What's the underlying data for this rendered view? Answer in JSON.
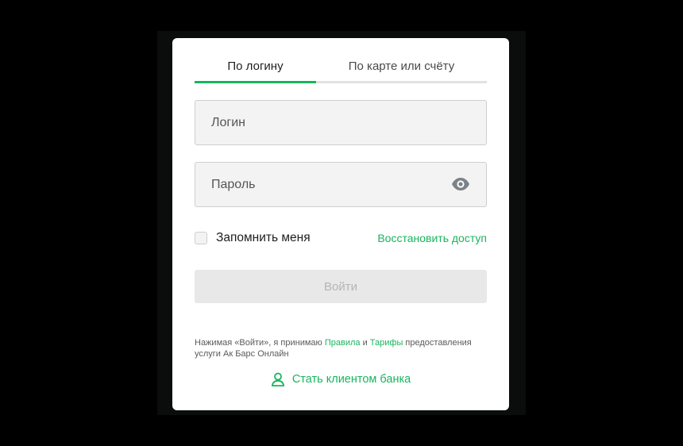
{
  "tabs": [
    {
      "label": "По логину",
      "active": true
    },
    {
      "label": "По карте или счёту",
      "active": false
    }
  ],
  "login": {
    "placeholder": "Логин",
    "value": ""
  },
  "password": {
    "placeholder": "Пароль",
    "value": "",
    "toggle_icon": "eye-icon"
  },
  "remember": {
    "label": "Запомнить меня",
    "checked": false
  },
  "restore_link": "Восстановить доступ",
  "submit": {
    "label": "Войти",
    "enabled": false
  },
  "terms": {
    "prefix": "Нажимая «Войти», я принимаю",
    "rules_link": "Правила",
    "and": "и",
    "tariffs_link": "Тарифы",
    "suffix": "предоставления услуги Ак Барс Онлайн"
  },
  "become_client": {
    "label": "Стать клиентом банка",
    "icon": "user-icon"
  },
  "colors": {
    "accent": "#17b55e",
    "background": "#000000",
    "card": "#ffffff",
    "field": "#f3f3f3"
  }
}
